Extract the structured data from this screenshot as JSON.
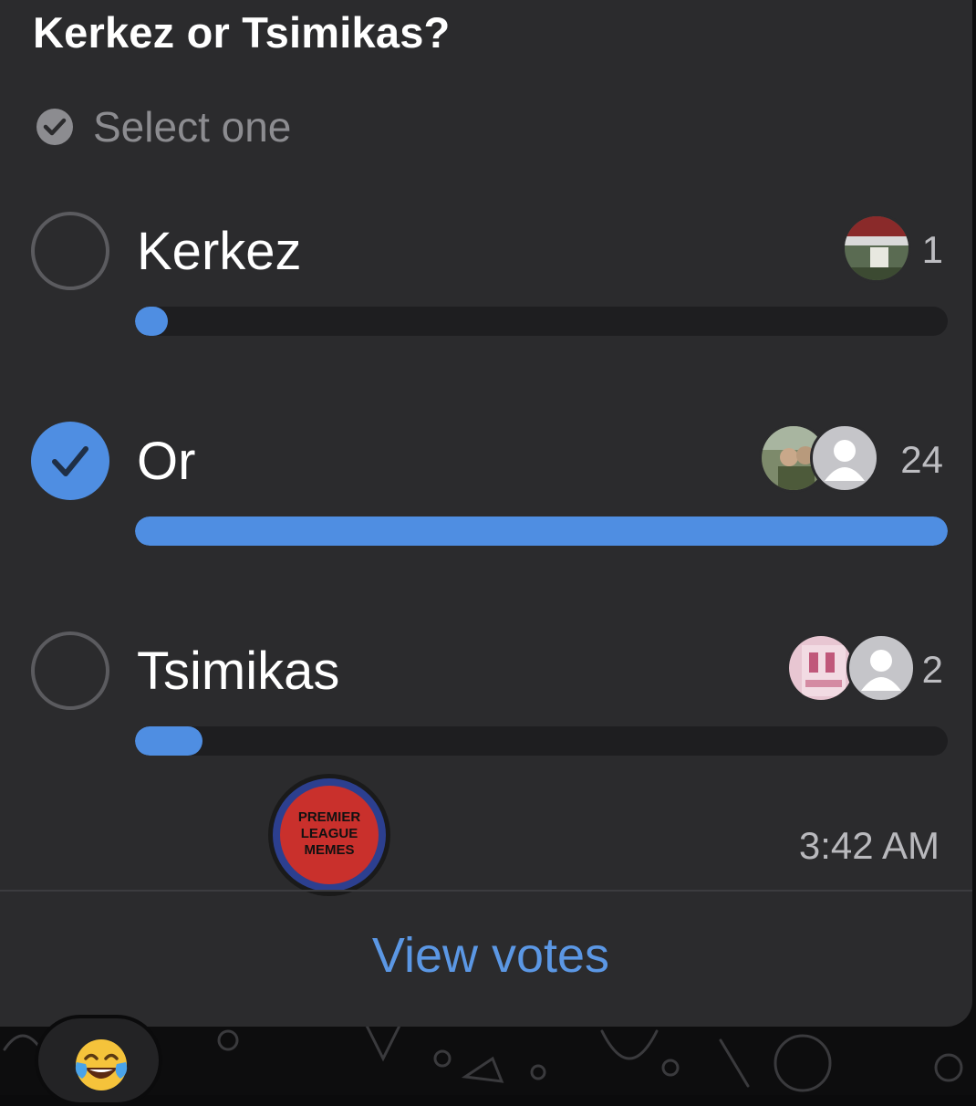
{
  "poll": {
    "question": "Kerkez or Tsimikas?",
    "hint": "Select one",
    "hint_icon": "check-circle-icon",
    "options": [
      {
        "label": "Kerkez",
        "selected": false,
        "votes": "1",
        "share": 0.04,
        "voter_avatars": [
          "photo-avatar"
        ]
      },
      {
        "label": "Or",
        "selected": true,
        "votes": "24",
        "share": 1.0,
        "voter_avatars": [
          "photo-avatar",
          "default-person-avatar"
        ]
      },
      {
        "label": "Tsimikas",
        "selected": false,
        "votes": "2",
        "share": 0.083,
        "voter_avatars": [
          "photo-avatar",
          "default-person-avatar"
        ]
      }
    ],
    "channel_logo_text": "PREMIER LEAGUE MEMES",
    "time": "3:42 AM",
    "view_votes_label": "View votes"
  },
  "reaction": {
    "emoji": "face-with-tears-of-joy-icon"
  },
  "colors": {
    "card": "#2b2b2d",
    "accent": "#4f8ee2",
    "track": "#1e1e20",
    "link": "#5b97e4",
    "muted_text": "#8c8c90"
  }
}
